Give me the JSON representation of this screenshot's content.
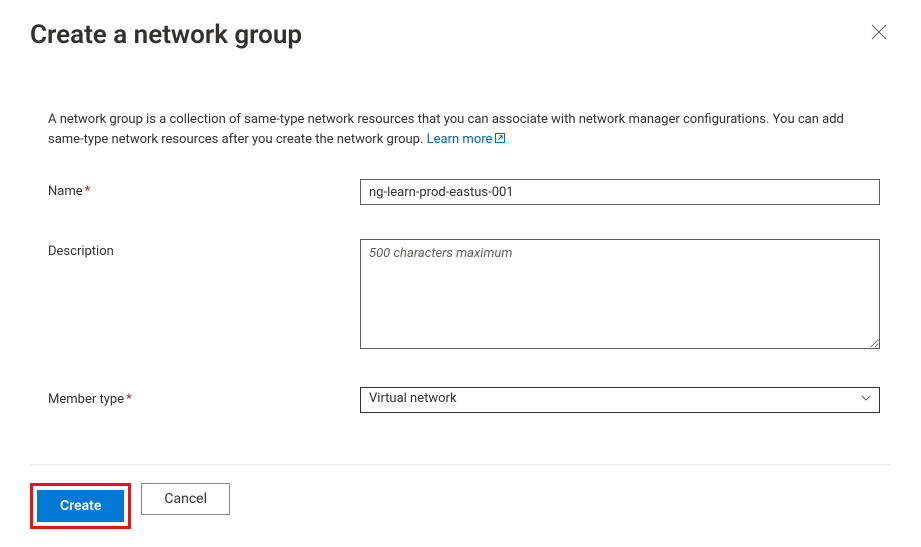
{
  "header": {
    "title": "Create a network group"
  },
  "intro": {
    "text": "A network group is a collection of same-type network resources that you can associate with network manager configurations. You can add same-type network resources after you create the network group.",
    "learn_more": "Learn more"
  },
  "form": {
    "name": {
      "label": "Name",
      "value": "ng-learn-prod-eastus-001"
    },
    "description": {
      "label": "Description",
      "placeholder": "500 characters maximum",
      "value": ""
    },
    "member_type": {
      "label": "Member type",
      "selected": "Virtual network"
    }
  },
  "footer": {
    "create_label": "Create",
    "cancel_label": "Cancel"
  }
}
